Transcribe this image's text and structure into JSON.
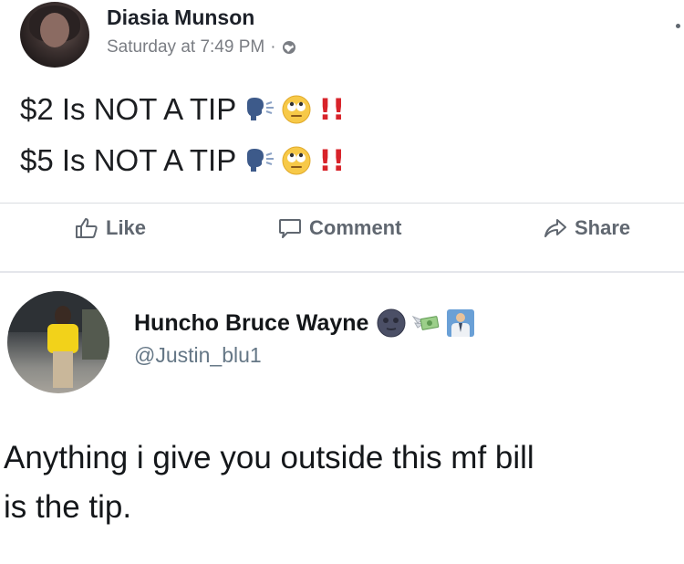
{
  "facebook_post": {
    "author": "Diasia Munson",
    "timestamp": "Saturday at 7:49 PM",
    "separator": "·",
    "privacy_icon": "globe-icon",
    "lines": [
      {
        "text": "$2 Is NOT A TIP",
        "emojis": [
          "speaking-head",
          "face-with-rolling-eyes"
        ],
        "emphasis": "!!"
      },
      {
        "text": "$5 Is NOT A TIP",
        "emojis": [
          "speaking-head",
          "face-with-rolling-eyes"
        ],
        "emphasis": "!!"
      }
    ],
    "actions": {
      "like_label": "Like",
      "comment_label": "Comment",
      "share_label": "Share"
    }
  },
  "tweet": {
    "display_name": "Huncho Bruce Wayne",
    "name_emojis": [
      "new-moon-face",
      "money-with-wings",
      "man-in-business-suit"
    ],
    "handle": "@Justin_blu1",
    "text_line_1": "Anything i give you outside this mf bill",
    "text_line_2": "is the tip."
  },
  "colors": {
    "action_gray": "#606770",
    "meta_gray": "#7a7d83",
    "handle_gray": "#657786",
    "bang_red": "#d8232a"
  }
}
